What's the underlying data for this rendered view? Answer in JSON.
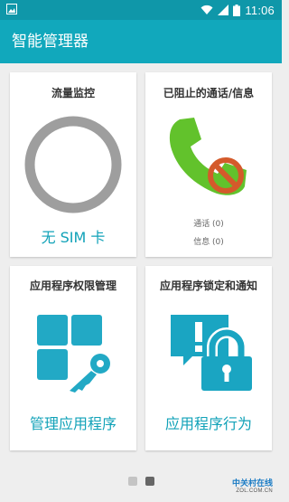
{
  "status_bar": {
    "time": "11:06",
    "icons": [
      "image-icon",
      "wifi-icon",
      "signal-icon",
      "battery-icon"
    ],
    "color": "#0f97a9"
  },
  "app_bar": {
    "title": "智能管理器",
    "color": "#11a8bc"
  },
  "cards": {
    "data_monitor": {
      "title": "流量监控",
      "action": "无 SIM 卡",
      "icon": "ring-icon"
    },
    "blocked": {
      "title": "已阻止的通话/信息",
      "calls": "通话 (0)",
      "messages": "信息 (0)",
      "icon": "phone-blocked-icon"
    },
    "permissions": {
      "title": "应用程序权限管理",
      "action": "管理应用程序",
      "icon": "grid-key-icon"
    },
    "lock_notify": {
      "title": "应用程序锁定和通知",
      "action": "应用程序行为",
      "icon": "alert-lock-icon"
    }
  },
  "pager": {
    "pages": 2,
    "active_page": 2
  },
  "watermark": {
    "line1": "中关村在线",
    "line2": "ZOL.COM.CN"
  },
  "colors": {
    "accent": "#11a2b8",
    "phone_green": "#62c22c",
    "block_orange": "#d45a2b",
    "ring_gray": "#9e9e9e"
  }
}
